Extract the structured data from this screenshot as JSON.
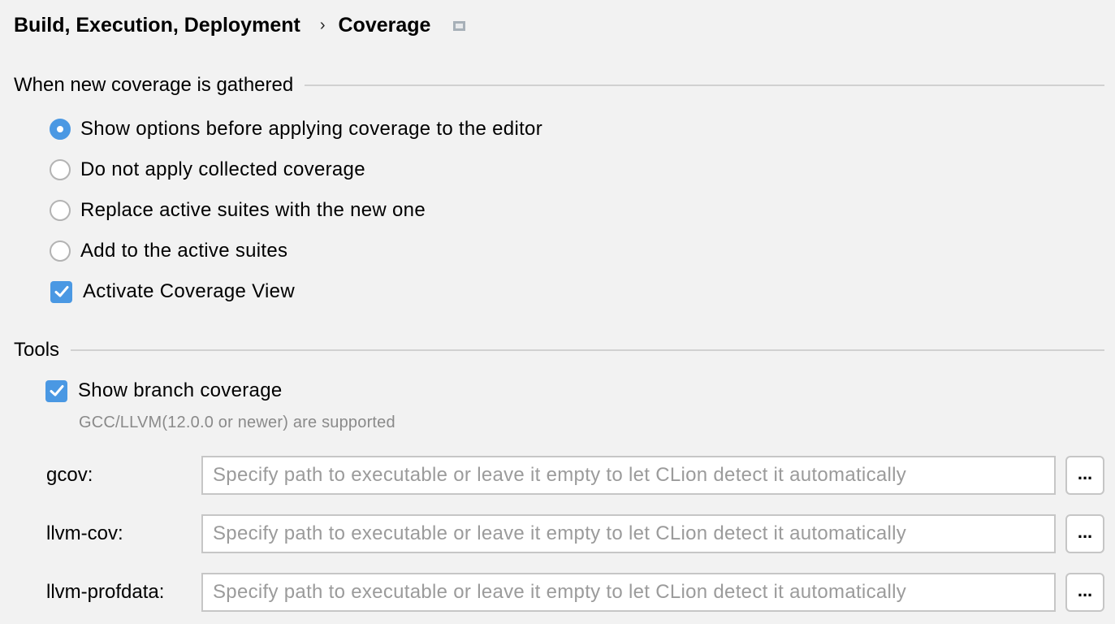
{
  "breadcrumb": {
    "parent": "Build, Execution, Deployment",
    "separator": "›",
    "current": "Coverage",
    "icon": "window-icon"
  },
  "sections": {
    "gathered": "When new coverage is gathered",
    "tools": "Tools"
  },
  "radio_options": [
    {
      "label": "Show options before applying coverage to the editor",
      "selected": true
    },
    {
      "label": "Do not apply collected coverage",
      "selected": false
    },
    {
      "label": "Replace active suites with the new one",
      "selected": false
    },
    {
      "label": "Add to the active suites",
      "selected": false
    }
  ],
  "checkboxes": {
    "activate_view": {
      "label": "Activate Coverage View",
      "checked": true
    },
    "branch_coverage": {
      "label": "Show branch coverage",
      "checked": true
    }
  },
  "hint": "GCC/LLVM(12.0.0 or newer) are supported",
  "fields": [
    {
      "label": "gcov:",
      "value": "",
      "placeholder": "Specify path to executable or leave it empty to let CLion detect it automatically",
      "browse": "..."
    },
    {
      "label": "llvm-cov:",
      "value": "",
      "placeholder": "Specify path to executable or leave it empty to let CLion detect it automatically",
      "browse": "..."
    },
    {
      "label": "llvm-profdata:",
      "value": "",
      "placeholder": "Specify path to executable or leave it empty to let CLion detect it automatically",
      "browse": "..."
    }
  ],
  "colors": {
    "accent": "#4a98e3",
    "background": "#f2f2f2"
  }
}
